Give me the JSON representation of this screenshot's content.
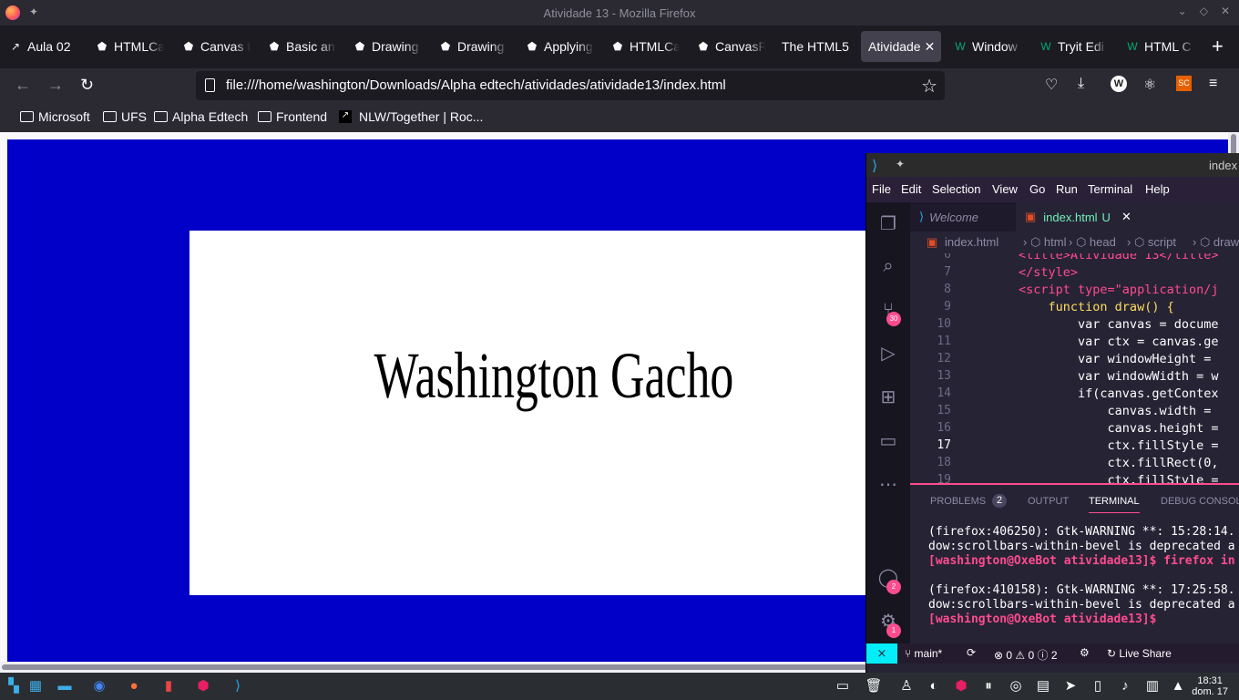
{
  "window": {
    "title": "Atividade 13 - Mozilla Firefox"
  },
  "tabs": [
    {
      "label": "Aula 02",
      "icon": "notion-icon"
    },
    {
      "label": "HTMLCa",
      "icon": "codepen-icon"
    },
    {
      "label": "Canvas t",
      "icon": "codepen-icon"
    },
    {
      "label": "Basic an",
      "icon": "codepen-icon"
    },
    {
      "label": "Drawing",
      "icon": "codepen-icon"
    },
    {
      "label": "Drawing",
      "icon": "codepen-icon"
    },
    {
      "label": "Applying",
      "icon": "codepen-icon"
    },
    {
      "label": "HTMLCa",
      "icon": "codepen-icon"
    },
    {
      "label": "CanvasR",
      "icon": "codepen-icon"
    },
    {
      "label": "The HTML5",
      "icon": ""
    },
    {
      "label": "Atividade",
      "icon": "",
      "active": true
    },
    {
      "label": "Window",
      "icon": "w3schools-icon"
    },
    {
      "label": "Tryit Edi",
      "icon": "w3schools-icon"
    },
    {
      "label": "HTML C",
      "icon": "w3schools-icon"
    }
  ],
  "toolbar": {
    "url": "file:///home/washington/Downloads/Alpha edtech/atividades/atividade13/index.html"
  },
  "bookmarks": [
    "Microsoft",
    "UFS",
    "Alpha Edtech",
    "Frontend",
    "NLW/Together | Roc..."
  ],
  "page": {
    "canvas_text": "Washington Gacho"
  },
  "vscode": {
    "title": "index",
    "menu": [
      "File",
      "Edit",
      "Selection",
      "View",
      "Go",
      "Run",
      "Terminal",
      "Help"
    ],
    "tabs": [
      {
        "label": "Welcome"
      },
      {
        "label": "index.html",
        "status": "U"
      }
    ],
    "breadcrumbs": [
      "index.html",
      "html",
      "head",
      "script",
      "draw"
    ],
    "badges": {
      "scm": "30",
      "accounts": "2",
      "settings": "1"
    },
    "code": [
      {
        "n": "6",
        "text": "        <title>Atividade 13</title>"
      },
      {
        "n": "7",
        "text": "        </style>"
      },
      {
        "n": "8",
        "text": "        <script type=\"application/j"
      },
      {
        "n": "9",
        "text": "            function draw() {"
      },
      {
        "n": "10",
        "text": "                var canvas = docume"
      },
      {
        "n": "11",
        "text": "                var ctx = canvas.ge"
      },
      {
        "n": "12",
        "text": "                var windowHeight ="
      },
      {
        "n": "13",
        "text": "                var windowWidth = w"
      },
      {
        "n": "14",
        "text": "                if(canvas.getContex"
      },
      {
        "n": "15",
        "text": "                    canvas.width ="
      },
      {
        "n": "16",
        "text": "                    canvas.height ="
      },
      {
        "n": "17",
        "text": "                    ctx.fillStyle ="
      },
      {
        "n": "18",
        "text": "                    ctx.fillRect(0,"
      },
      {
        "n": "19",
        "text": "                    ctx.fillStyle ="
      }
    ],
    "panel_tabs": [
      "PROBLEMS",
      "2",
      "OUTPUT",
      "TERMINAL",
      "DEBUG CONSOLE"
    ],
    "terminal": [
      "(firefox:406250): Gtk-WARNING **: 15:28:14.",
      "dow:scrollbars-within-bevel is deprecated a",
      "[washington@OxeBot atividade13]$ firefox in",
      "",
      "(firefox:410158): Gtk-WARNING **: 17:25:58.",
      "dow:scrollbars-within-bevel is deprecated a",
      "[washington@OxeBot atividade13]$ "
    ],
    "status": {
      "branch": "main*",
      "problems": "0",
      "warnings": "0",
      "info": "2",
      "live_share": "Live Share"
    }
  },
  "taskbar": {
    "time": "18:31",
    "date": "dom. 17"
  },
  "colors": {
    "canvas_bg": "#0000c9",
    "accent": "#fe4c8e"
  }
}
